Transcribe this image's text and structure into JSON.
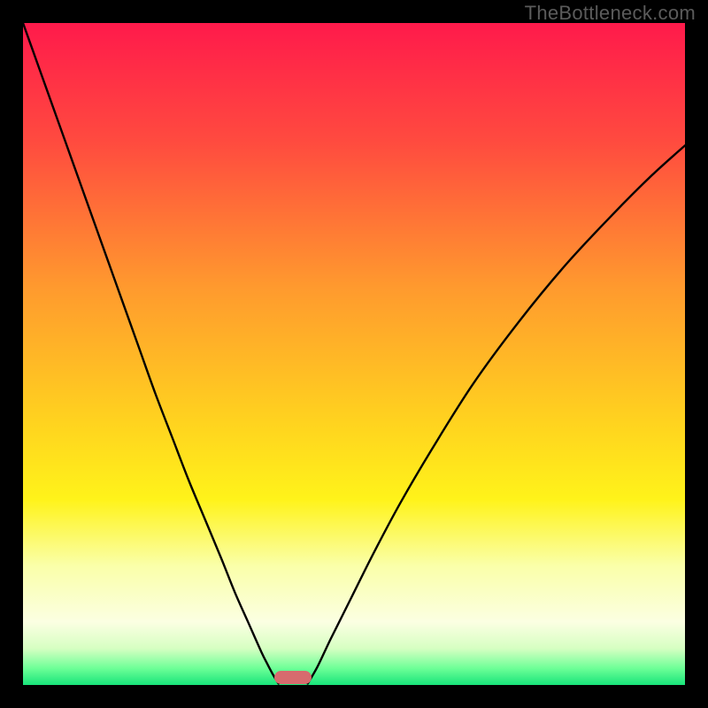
{
  "watermark": "TheBottleneck.com",
  "chart_data": {
    "type": "line",
    "title": "",
    "xlabel": "",
    "ylabel": "",
    "xlim": [
      0,
      100
    ],
    "ylim": [
      0,
      100
    ],
    "gradient_stops": [
      {
        "offset": 0,
        "color": "#ff1a4b"
      },
      {
        "offset": 0.18,
        "color": "#ff4b3f"
      },
      {
        "offset": 0.4,
        "color": "#ff9a2e"
      },
      {
        "offset": 0.6,
        "color": "#ffd21f"
      },
      {
        "offset": 0.72,
        "color": "#fff31a"
      },
      {
        "offset": 0.82,
        "color": "#faffa9"
      },
      {
        "offset": 0.905,
        "color": "#fbffe2"
      },
      {
        "offset": 0.945,
        "color": "#d6ffc2"
      },
      {
        "offset": 0.975,
        "color": "#6dff97"
      },
      {
        "offset": 1.0,
        "color": "#18e47a"
      }
    ],
    "series": [
      {
        "name": "left-curve",
        "x": [
          0.0,
          2.5,
          5.0,
          7.5,
          10.0,
          12.5,
          15.0,
          17.5,
          20.0,
          22.5,
          25.0,
          27.5,
          30.0,
          32.0,
          34.0,
          36.0,
          37.0,
          37.8,
          38.6
        ],
        "y": [
          100,
          93,
          86,
          79,
          72,
          65,
          58,
          51,
          44,
          37.5,
          31,
          25,
          19,
          14,
          9.5,
          5,
          3,
          1.5,
          0.2
        ]
      },
      {
        "name": "right-curve",
        "x": [
          43.0,
          44.5,
          46.5,
          49.5,
          53.0,
          57.0,
          62.0,
          68.0,
          75.0,
          82.0,
          89.0,
          95.0,
          100.0
        ],
        "y": [
          0.2,
          2.8,
          7.0,
          13.0,
          20.0,
          27.5,
          36.0,
          45.5,
          55.0,
          63.5,
          71.0,
          77.0,
          81.5
        ]
      }
    ],
    "marker": {
      "x_center": 40.8,
      "width": 5.6,
      "height": 2.0
    }
  }
}
